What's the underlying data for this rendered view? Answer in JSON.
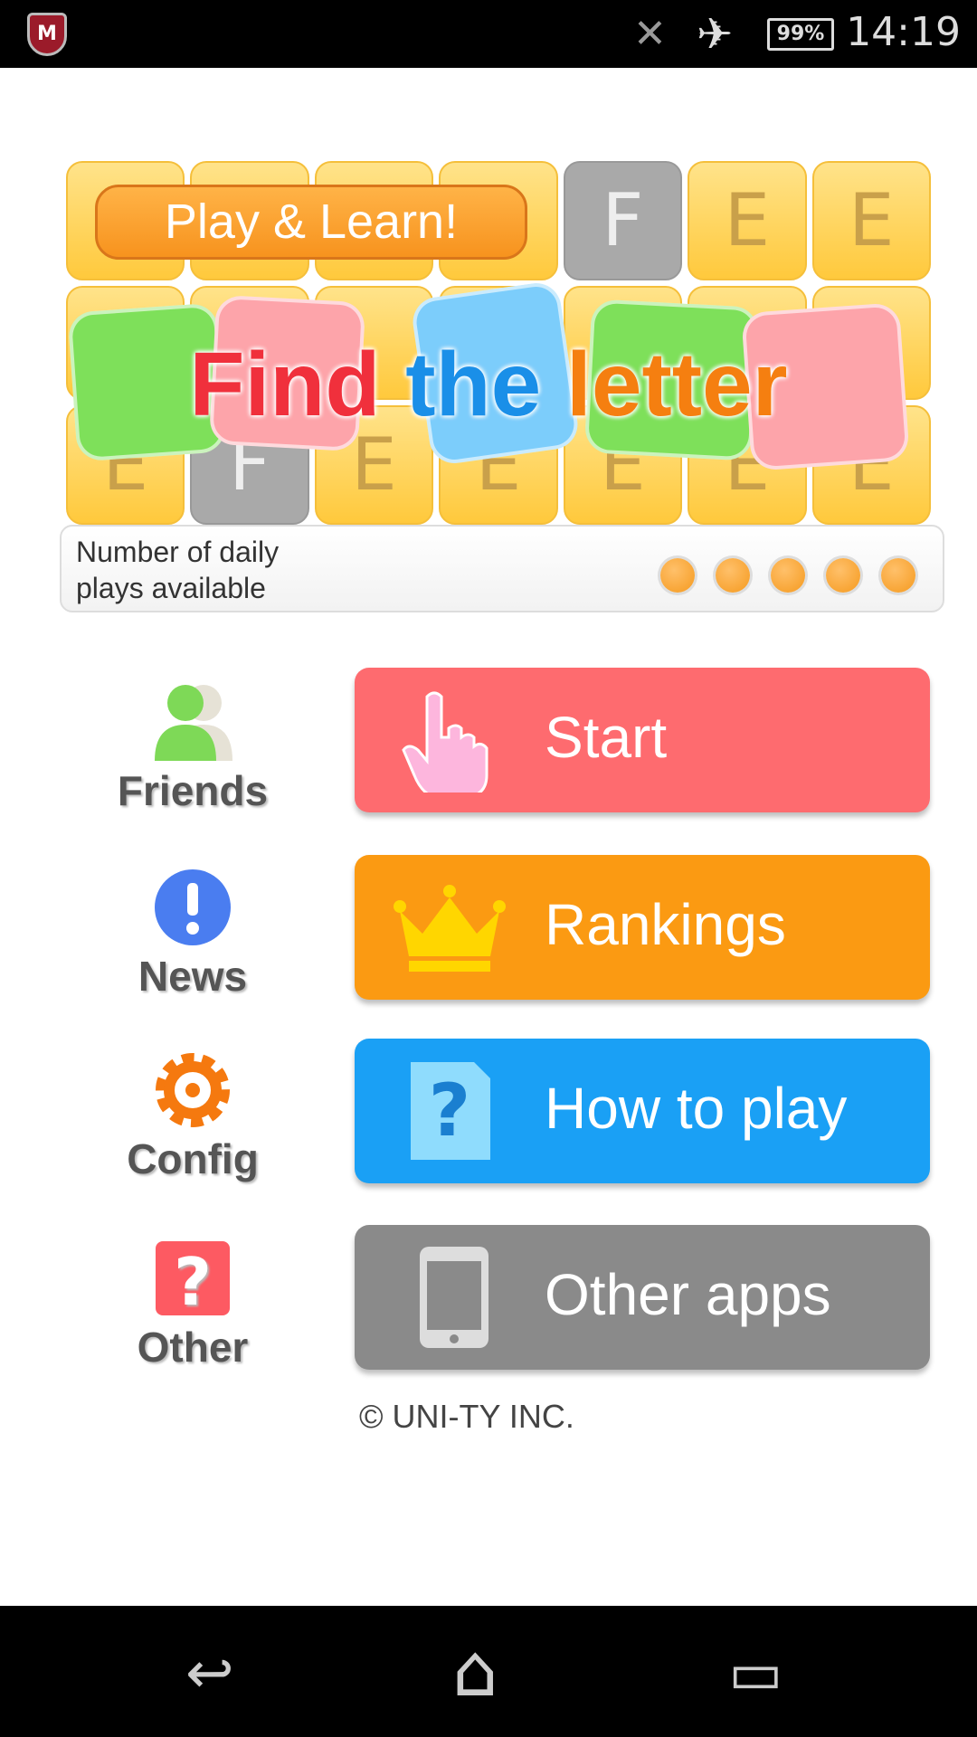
{
  "status_bar": {
    "time": "14:19",
    "battery": "99%",
    "icons": [
      "mcafee-shield-icon",
      "nfc-off-icon",
      "airplane-icon",
      "battery-icon"
    ],
    "shield_letter": "M"
  },
  "banner": {
    "tagline": "Play & Learn!",
    "tiles": [
      "",
      "",
      "",
      "",
      "F",
      "E",
      "E",
      "",
      "",
      "",
      "",
      "",
      "",
      "",
      "E",
      "F",
      "E",
      "E",
      "E",
      "E",
      "E"
    ],
    "title_words": [
      {
        "text": "Find",
        "color": "#f0303c"
      },
      {
        "text": "the",
        "color": "#1a8fe8"
      },
      {
        "text": "letter",
        "color": "#f57f10"
      }
    ]
  },
  "daily_plays": {
    "label_line1": "Number of daily",
    "label_line2": "plays available",
    "available": 5,
    "total": 5
  },
  "buttons": [
    {
      "label": "Start",
      "color": "#fe6b6f",
      "icon": "pointing-hand-icon"
    },
    {
      "label": "Rankings",
      "color": "#fb9a12",
      "icon": "crown-icon"
    },
    {
      "label": "How to play",
      "color": "#1aa0f5",
      "icon": "question-document-icon"
    },
    {
      "label": "Other apps",
      "color": "#8a8a8a",
      "icon": "smartphone-icon"
    }
  ],
  "side": [
    {
      "label": "Friends",
      "icon": "friends-icon"
    },
    {
      "label": "News",
      "icon": "exclamation-icon"
    },
    {
      "label": "Config",
      "icon": "gear-icon"
    },
    {
      "label": "Other",
      "icon": "question-icon"
    }
  ],
  "copyright": "© UNI-TY INC.",
  "nav": {
    "back": "↩",
    "home": "⌂",
    "recents": "▭"
  }
}
